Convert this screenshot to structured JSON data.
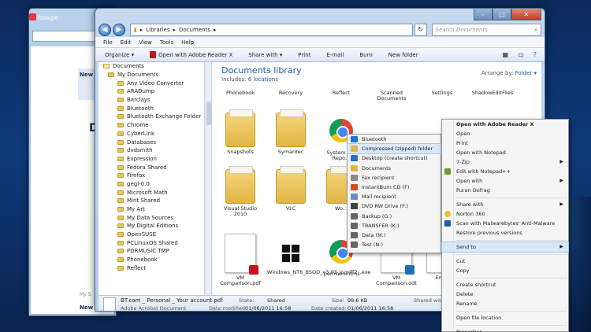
{
  "browser": {
    "title": "iGoogle",
    "new_label_1": "New",
    "letter_d": "D",
    "new_label_2": "New",
    "my_label": "My S"
  },
  "explorer": {
    "breadcrumb": [
      "Libraries",
      "Documents"
    ],
    "search_placeholder": "Search Documents",
    "menu": [
      "File",
      "Edit",
      "View",
      "Tools",
      "Help"
    ],
    "commands": [
      "Organize ▾",
      "Open with Adobe Reader X",
      "Share with ▾",
      "Print",
      "E-mail",
      "Burn",
      "New folder"
    ],
    "library_title": "Documents library",
    "includes_prefix": "Includes:",
    "includes_link": "6 locations",
    "arrange_prefix": "Arrange by:",
    "arrange_value": "Folder ▾",
    "nav_items": [
      "Documents",
      "My Documents",
      "Any Video Converter",
      "ARADump",
      "Barclays",
      "Bluetooth",
      "Bluetooth Exchange Folder",
      "Chrome",
      "CyberLink",
      "Databases",
      "dvdsmith",
      "Expression",
      "Fedora Shared",
      "Firefox",
      "gegl-0.0",
      "Microsoft Math",
      "Mint Shared",
      "My Art",
      "My Data Sources",
      "My Digital Editions",
      "OpenSUSE",
      "PCLinuxOS Shared",
      "PDRMUSIC.TMP",
      "Phonebook",
      "Reflect"
    ],
    "row1": [
      "Phonebook",
      "Recovery",
      "Reflect",
      "Scanned Documents",
      "Settings",
      "ShadowEditFiles"
    ],
    "row2": [
      "Snapshots",
      "Symantec",
      "System H... Repo..."
    ],
    "row3": [
      "Visual Studio 2010",
      "VLC",
      "Wo..."
    ],
    "row4": [
      "VM Comparison.pdf",
      "Windows_NT6_BSOD_v3.03_jcgriff2_.exe",
      "perfmon.html",
      "VM Comparison.odt",
      "Em..."
    ],
    "details": {
      "filename": "BT.com _ Personal _ Your account.pdf",
      "state_label": "State:",
      "state_value": "Shared",
      "size_label": "Size:",
      "size_value": "98.6 KB",
      "shared_label": "Shared with:",
      "type": "Adobe Acrobat Document",
      "modified_label": "Date modified:",
      "modified_value": "01/06/2011 16:58",
      "created_label": "Date created:",
      "created_value": "01/06/2011 16:58"
    }
  },
  "sendto_menu": [
    "Bluetooth",
    "Compressed (zipped) folder",
    "Desktop (create shortcut)",
    "Documents",
    "Fax recipient",
    "InstantBurn CD (F)",
    "Mail recipient",
    "DVD RW Drive (F:)",
    "Backup (G:)",
    "TRANSFER (K:)",
    "Data (M:)",
    "Test (N:)"
  ],
  "sendto_highlight": 1,
  "context_menu": {
    "g1": [
      "Open with Adobe Reader X",
      "Open",
      "Print",
      "Open with Notepad",
      "7-Zip",
      "Edit with Notepad++",
      "Open with",
      "Puran Defrag"
    ],
    "g2": [
      "Share with",
      "Norton 360",
      "Scan with Malwarebytes' Anti-Malware",
      "Restore previous versions"
    ],
    "g3": [
      "Send to"
    ],
    "g4": [
      "Cut",
      "Copy"
    ],
    "g5": [
      "Create shortcut",
      "Delete",
      "Rename"
    ],
    "g6": [
      "Open file location"
    ],
    "g7": [
      "Properties"
    ]
  },
  "colors": {
    "accent": "#1e5aa8",
    "highlight": "#d9e8f9",
    "pdf_red": "#c4141b",
    "folder": "#e8c55a"
  }
}
